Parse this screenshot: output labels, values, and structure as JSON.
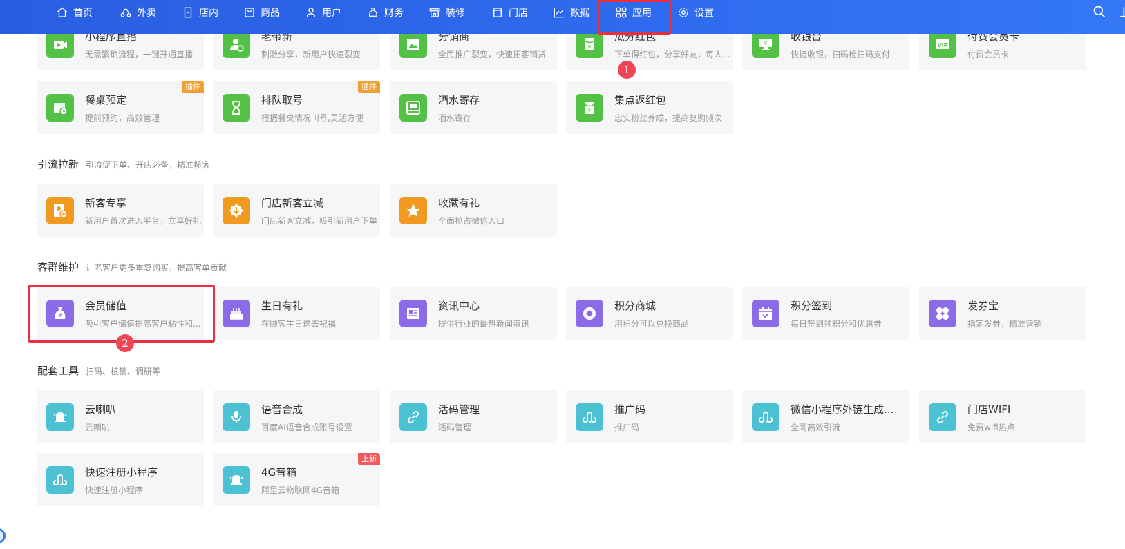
{
  "nav": {
    "items": [
      {
        "label": "首页",
        "icon": "home-icon"
      },
      {
        "label": "外卖",
        "icon": "delivery-icon"
      },
      {
        "label": "店内",
        "icon": "store-door-icon"
      },
      {
        "label": "商品",
        "icon": "goods-icon"
      },
      {
        "label": "用户",
        "icon": "user-icon"
      },
      {
        "label": "财务",
        "icon": "finance-icon"
      },
      {
        "label": "装修",
        "icon": "decorate-icon"
      },
      {
        "label": "门店",
        "icon": "shop-icon"
      },
      {
        "label": "数据",
        "icon": "chart-icon"
      },
      {
        "label": "应用",
        "icon": "apps-icon"
      },
      {
        "label": "设置",
        "icon": "gear-icon"
      }
    ]
  },
  "sections": {
    "marketing_top": {
      "cards": [
        {
          "name": "小程序直播",
          "desc": "无需繁琐流程，一键开通直播",
          "icon": "video-icon",
          "color": "#52c145"
        },
        {
          "name": "老带新",
          "desc": "刺激分享，新用户快速裂变",
          "icon": "user-add-icon",
          "color": "#52c145"
        },
        {
          "name": "分销商",
          "desc": "全民推广裂变，快速拓客销货",
          "icon": "image-icon",
          "color": "#52c145"
        },
        {
          "name": "瓜分红包",
          "desc": "下单得红包，分享好友，每人...",
          "icon": "red-packet-icon",
          "color": "#52c145"
        },
        {
          "name": "收银台",
          "desc": "快捷收银，扫码枪扫码支付",
          "icon": "cashier-icon",
          "color": "#52c145"
        },
        {
          "name": "付费会员卡",
          "desc": "付费会员卡",
          "icon": "vip-card-icon",
          "color": "#52c145"
        },
        {
          "name": "餐桌预定",
          "desc": "提前预约，高效管理",
          "icon": "calendar-clock-icon",
          "color": "#52c145",
          "badge": "插件"
        },
        {
          "name": "排队取号",
          "desc": "根据餐桌情况叫号,灵活方便",
          "icon": "hourglass-icon",
          "color": "#52c145",
          "badge": "插件"
        },
        {
          "name": "酒水寄存",
          "desc": "酒水寄存",
          "icon": "storage-icon",
          "color": "#52c145"
        },
        {
          "name": "集点返红包",
          "desc": "忠实粉丝养成，提高复购频次",
          "icon": "red-packet-icon",
          "color": "#52c145"
        }
      ]
    },
    "traffic": {
      "title": "引流拉新",
      "desc": "引流促下单、开店必备，精准揽客",
      "cards": [
        {
          "name": "新客专享",
          "desc": "新用户首次进入平台，立享好礼",
          "icon": "new-user-icon",
          "color": "#f19a22"
        },
        {
          "name": "门店新客立减",
          "desc": "门店新客立减，吸引新用户下单",
          "icon": "discount-icon",
          "color": "#f19a22"
        },
        {
          "name": "收藏有礼",
          "desc": "全面抢占微信入口",
          "icon": "star-icon",
          "color": "#f19a22"
        }
      ]
    },
    "retention": {
      "title": "客群维护",
      "desc": "让老客户更多重复购买，提高客单贡献",
      "cards": [
        {
          "name": "会员储值",
          "desc": "吸引客户储值提高客户粘性和...",
          "icon": "money-bag-icon",
          "color": "#8c6be8"
        },
        {
          "name": "生日有礼",
          "desc": "在顾客生日送去祝福",
          "icon": "cake-icon",
          "color": "#8c6be8"
        },
        {
          "name": "资讯中心",
          "desc": "提供行业的最热新闻资讯",
          "icon": "news-icon",
          "color": "#8c6be8"
        },
        {
          "name": "积分商城",
          "desc": "用积分可以兑换商品",
          "icon": "diamond-icon",
          "color": "#8c6be8"
        },
        {
          "name": "积分签到",
          "desc": "每日签到领积分和优惠券",
          "icon": "calendar-check-icon",
          "color": "#8c6be8"
        },
        {
          "name": "发券宝",
          "desc": "指定发券，精准营销",
          "icon": "grid-icon",
          "color": "#8c6be8"
        }
      ]
    },
    "tools": {
      "title": "配套工具",
      "desc": "扫码、核销、调研等",
      "cards": [
        {
          "name": "云喇叭",
          "desc": "云喇叭",
          "icon": "bell-icon",
          "color": "#4cc1d3"
        },
        {
          "name": "语音合成",
          "desc": "百度AI语音合成账号设置",
          "icon": "microphone-icon",
          "color": "#4cc1d3"
        },
        {
          "name": "活码管理",
          "desc": "活码管理",
          "icon": "link-icon",
          "color": "#4cc1d3"
        },
        {
          "name": "推广码",
          "desc": "推广码",
          "icon": "miniprogram-icon",
          "color": "#4cc1d3"
        },
        {
          "name": "微信小程序外链生成...",
          "desc": "全网高效引流",
          "icon": "miniprogram-icon",
          "color": "#4cc1d3"
        },
        {
          "name": "门店WIFI",
          "desc": "免费wifi热点",
          "icon": "link-icon",
          "color": "#4cc1d3"
        },
        {
          "name": "快速注册小程序",
          "desc": "快速注册小程序",
          "icon": "miniprogram-icon",
          "color": "#4cc1d3"
        },
        {
          "name": "4G音箱",
          "desc": "阿里云物联网4G音箱",
          "icon": "bell-icon",
          "color": "#4cc1d3",
          "badge": "上新"
        }
      ]
    }
  },
  "badge_colors": {
    "插件": "#f0a030",
    "上新": "#f05a5a"
  },
  "annotations": {
    "marker1": "1",
    "marker2": "2",
    "highlight_color": "#e8303f"
  }
}
